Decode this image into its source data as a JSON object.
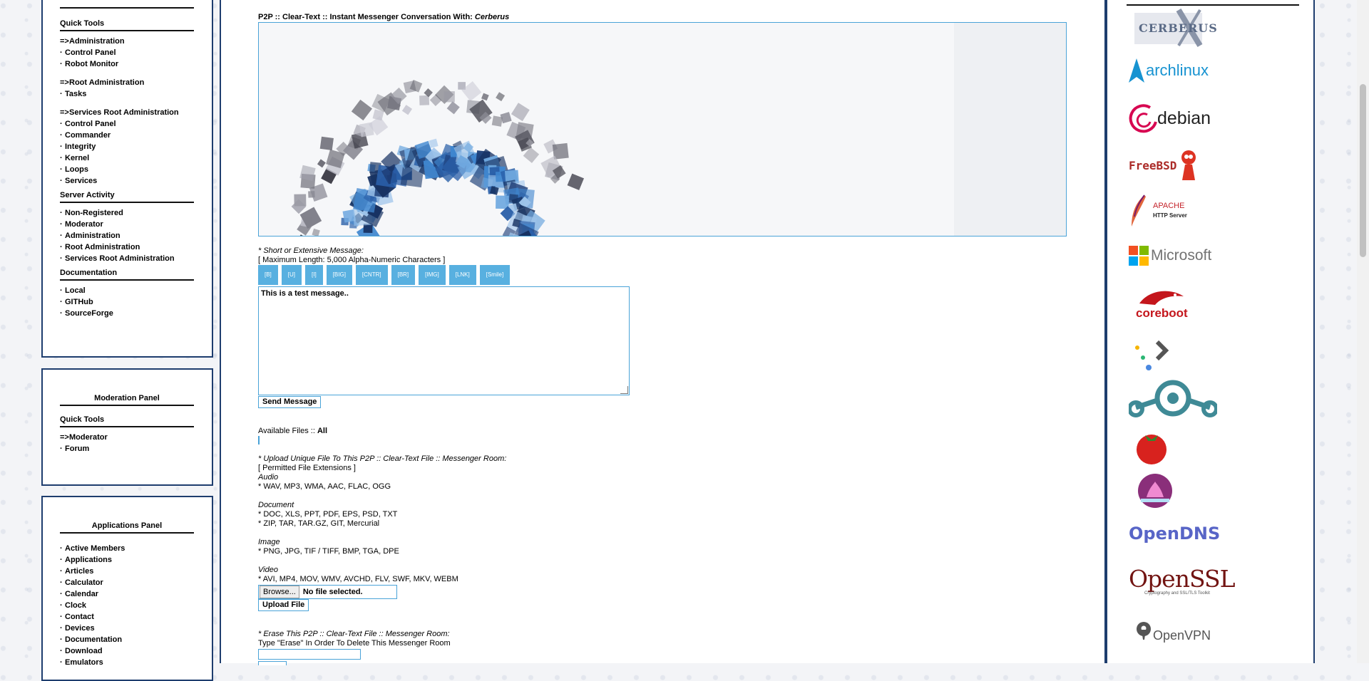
{
  "left": {
    "main_panel": {
      "sections": [
        {
          "heading": "Quick Tools",
          "items": [
            [
              "=> ",
              "Administration"
            ],
            [
              "· ",
              "Control Panel"
            ],
            [
              "· ",
              "Robot Monitor"
            ],
            null,
            [
              "=> ",
              "Root Administration"
            ],
            [
              "· ",
              "Tasks"
            ],
            null,
            [
              "=> ",
              "Services Root Administration"
            ],
            [
              "· ",
              "Control Panel"
            ],
            [
              "· ",
              "Commander"
            ],
            [
              "· ",
              "Integrity"
            ],
            [
              "· ",
              "Kernel"
            ],
            [
              "· ",
              "Loops"
            ],
            [
              "· ",
              "Services"
            ]
          ]
        },
        {
          "heading": "Server Activity",
          "items": [
            [
              "· ",
              "Non-Registered"
            ],
            [
              "· ",
              "Moderator"
            ],
            [
              "· ",
              "Administration"
            ],
            [
              "· ",
              "Root Administration"
            ],
            [
              "· ",
              "Services Root Administration"
            ]
          ]
        },
        {
          "heading": "Documentation",
          "items": [
            [
              "· ",
              "Local"
            ],
            [
              "· ",
              "GITHub"
            ],
            [
              "· ",
              "SourceForge"
            ]
          ]
        }
      ]
    },
    "moderation_panel": {
      "title": "Moderation Panel",
      "heading": "Quick Tools",
      "items": [
        [
          "=> ",
          "Moderator"
        ],
        [
          "· ",
          "Forum"
        ]
      ]
    },
    "applications_panel": {
      "title": "Applications Panel",
      "items": [
        [
          "· ",
          "Active Members"
        ],
        [
          "· ",
          "Applications"
        ],
        [
          "· ",
          "Articles"
        ],
        [
          "· ",
          "Calculator"
        ],
        [
          "· ",
          "Calendar"
        ],
        [
          "· ",
          "Clock"
        ],
        [
          "· ",
          "Contact"
        ],
        [
          "· ",
          "Devices"
        ],
        [
          "· ",
          "Documentation"
        ],
        [
          "· ",
          "Download"
        ],
        [
          "· ",
          "Emulators"
        ]
      ]
    }
  },
  "conversation": {
    "title_prefix": "P2P :: Clear-Text :: Instant Messenger Conversation With: ",
    "title_user": "Cerberus",
    "message_label": "* Short or Extensive Message:",
    "message_max": "[ Maximum Length: 5,000 Alpha-Numeric Characters ]",
    "toolbar": [
      "[B]",
      "[U]",
      "[I]",
      "[BIG]",
      "[CNTR]",
      "[BR]",
      "[IMG]",
      "[LNK]",
      "[Smile]"
    ],
    "message_value": "This is a test message..",
    "send_label": "Send Message",
    "files_label": "Available Files :: ",
    "files_value": "All",
    "upload_heading": "* Upload Unique File To This P2P :: Clear-Text File :: Messenger Room:",
    "permitted": "[ Permitted File Extensions ]",
    "audio_label": "Audio",
    "audio_ext": "* WAV, MP3, WMA, AAC, FLAC, OGG",
    "document_label": "Document",
    "document_ext1": "* DOC, XLS, PPT, PDF, EPS, PSD, TXT",
    "document_ext2": "* ZIP, TAR, TAR.GZ, GIT, Mercurial",
    "image_label": "Image",
    "image_ext": "* PNG, JPG, TIF / TIFF, BMP, TGA, DPE",
    "video_label": "Video",
    "video_ext": "* AVI, MP4, MOV, WMV, AVCHD, FLV, SWF, MKV, WEBM",
    "browse_label": "Browse...",
    "file_status": "No file selected.",
    "upload_label": "Upload File",
    "erase_heading": "* Erase This P2P :: Clear-Text File :: Messenger Room:",
    "erase_instruction": "Type \"Erase\" In Order To Delete This Messenger Room"
  },
  "logos": [
    {
      "name": "cerberus-logo",
      "text": "CERBERUS",
      "color": "#5a6a86"
    },
    {
      "name": "archlinux-logo",
      "text": "archlinux",
      "color": "#1793d1"
    },
    {
      "name": "debian-logo",
      "text": "debian",
      "color": "#222222",
      "accent": "#d70751"
    },
    {
      "name": "freebsd-logo",
      "text": "FreeBSD",
      "color": "#ab2b28"
    },
    {
      "name": "apache-logo",
      "text": "APACHE",
      "sub": "HTTP Server",
      "color": "#c4232b"
    },
    {
      "name": "microsoft-logo",
      "text": "Microsoft",
      "color": "#737373"
    },
    {
      "name": "coreboot-logo",
      "text": "coreboot",
      "color": "#c4161c"
    },
    {
      "name": "code-dots-logo",
      "text": "",
      "color": "#4a88e0"
    },
    {
      "name": "lineageos-logo",
      "text": "",
      "color": "#3f8a96"
    },
    {
      "name": "tomato-logo",
      "text": "",
      "color": "#d8221e"
    },
    {
      "name": "lotus-logo",
      "text": "",
      "color": "#8a2f7a"
    },
    {
      "name": "opendns-logo",
      "text": "OpenDNS",
      "color": "#5865c7"
    },
    {
      "name": "openssl-logo",
      "text": "OpenSSL",
      "sub": "Cryptography and SSL/TLS Toolkit",
      "color": "#721412"
    },
    {
      "name": "openvpn-logo",
      "text": "OpenVPN",
      "color": "#555555"
    }
  ]
}
